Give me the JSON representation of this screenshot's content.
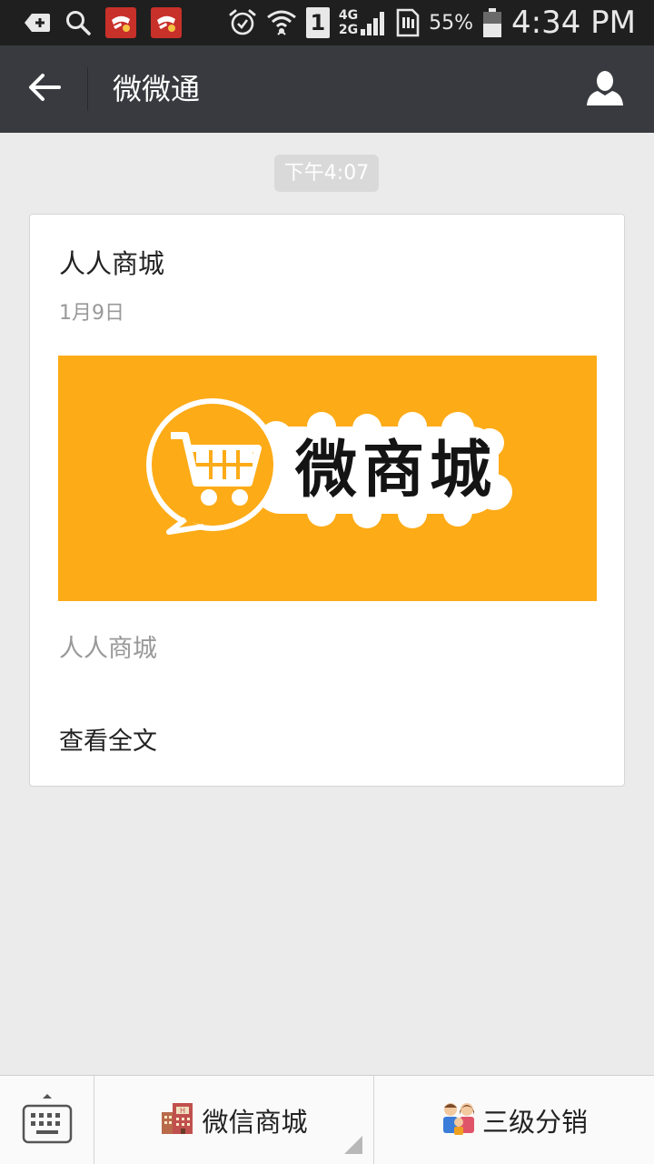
{
  "status_bar": {
    "icons_left": [
      "add-box-icon",
      "search-icon",
      "app-notification-icon",
      "app-notification-icon"
    ],
    "icons_right": [
      "alarm-icon",
      "wifi-icon",
      "sim-icon",
      "signal-icon",
      "sd-card-icon",
      "battery-icon"
    ],
    "sim_slot": "1",
    "net_type_top": "4G",
    "net_type_bottom": "2G",
    "battery_percent": "55%",
    "time": "4:34 PM"
  },
  "title_bar": {
    "title": "微微通",
    "back_icon": "arrow-left-icon",
    "profile_icon": "person-icon"
  },
  "chat": {
    "timestamp": "下午4:07",
    "article": {
      "title": "人人商城",
      "date": "1月9日",
      "banner_text": "微商城",
      "banner_color": "#fdab17",
      "digest": "人人商城",
      "read_more": "查看全文"
    }
  },
  "bottom_menu": {
    "keyboard_icon": "keyboard-icon",
    "items": [
      {
        "label": "微信商城",
        "icon": "building-icon",
        "has_submenu": true
      },
      {
        "label": "三级分销",
        "icon": "family-icon",
        "has_submenu": false
      }
    ]
  },
  "colors": {
    "status_bar_bg": "#1f1f1f",
    "title_bar_bg": "#393a3f",
    "chat_bg": "#ebebeb",
    "banner_bg": "#fdab17"
  }
}
